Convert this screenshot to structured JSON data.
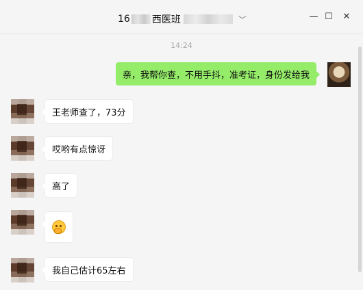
{
  "window": {
    "title_prefix": "16",
    "title_main": "西医班",
    "minimize": "—",
    "maximize": "☐",
    "close": "✕"
  },
  "chat": {
    "timestamp": "14:24",
    "outgoing": [
      {
        "text": "亲，我帮你查，不用手抖，准考证，身份发给我"
      }
    ],
    "incoming": [
      {
        "text": "王老师查了，73分"
      },
      {
        "text": "哎哟有点惊讶"
      },
      {
        "text": "高了"
      },
      {
        "text": "",
        "emoji": "thinking-face-icon"
      },
      {
        "text": "我自己估计65左右"
      }
    ]
  },
  "colors": {
    "sent_bubble": "#95ec69",
    "received_bubble": "#ffffff",
    "background": "#f5f5f5"
  }
}
